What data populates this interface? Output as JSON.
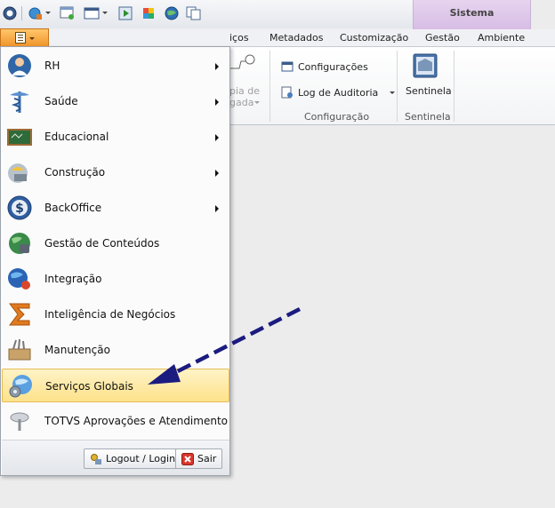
{
  "contextual_group": {
    "title": "Sistema"
  },
  "tabs": [
    {
      "label": "iços"
    },
    {
      "label": "Metadados"
    },
    {
      "label": "Customização"
    },
    {
      "label": "Gestão"
    },
    {
      "label": "Ambiente"
    }
  ],
  "ribbon": {
    "hidden_partial_1": "pia de",
    "hidden_partial_2": "gada",
    "configuracao_group": {
      "label": "Configuração",
      "items": [
        {
          "label": "Configurações"
        },
        {
          "label": "Log de Auditoria"
        }
      ]
    },
    "sentinela_group": {
      "label": "Sentinela",
      "button_label": "Sentinela"
    }
  },
  "app_menu": {
    "items": [
      {
        "label": "RH",
        "icon": "user-doctor-icon",
        "submenu": true
      },
      {
        "label": "Saúde",
        "icon": "caduceus-icon",
        "submenu": true
      },
      {
        "label": "Educacional",
        "icon": "chalkboard-icon",
        "submenu": true
      },
      {
        "label": "Construção",
        "icon": "construction-icon",
        "submenu": true
      },
      {
        "label": "BackOffice",
        "icon": "dollar-icon",
        "submenu": true
      },
      {
        "label": "Gestão de Conteúdos",
        "icon": "globe-content-icon",
        "submenu": false
      },
      {
        "label": "Integração",
        "icon": "integration-icon",
        "submenu": false
      },
      {
        "label": "Inteligência de Negócios",
        "icon": "sigma-icon",
        "submenu": false
      },
      {
        "label": "Manutenção",
        "icon": "toolbox-icon",
        "submenu": false
      },
      {
        "label": "Serviços Globais",
        "icon": "globe-gear-icon",
        "submenu": false,
        "highlighted": true
      },
      {
        "label": "TOTVS Aprovações e Atendimento",
        "icon": "approval-icon",
        "submenu": false
      }
    ],
    "footer": {
      "logout_label": "Logout / Login",
      "exit_label": "Sair"
    }
  },
  "colors": {
    "highlight": "#fde28b",
    "app_button": "#f1952b",
    "contextual_tab": "#d7bde4",
    "annotation_arrow": "#1b1b80"
  }
}
